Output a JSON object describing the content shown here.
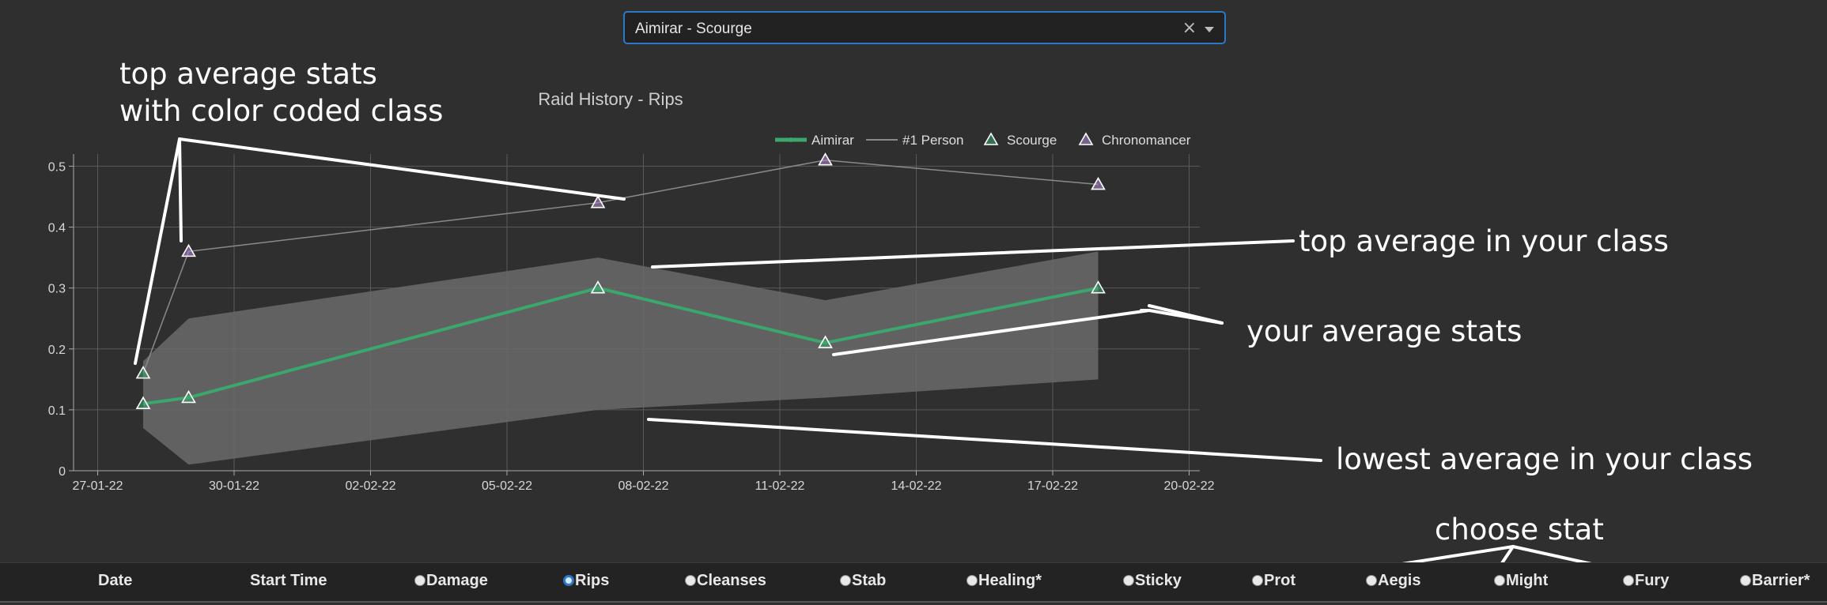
{
  "select": {
    "value": "Aimirar - Scourge",
    "clear_glyph": "×",
    "icons": [
      "clear-icon",
      "chevron-down-icon"
    ]
  },
  "chart_data": {
    "type": "line",
    "title": "Raid History - Rips",
    "x_ticks": [
      "27-01-22",
      "30-01-22",
      "02-02-22",
      "05-02-22",
      "08-02-22",
      "11-02-22",
      "14-02-22",
      "17-02-22",
      "20-02-22"
    ],
    "y_ticks": [
      "0",
      "0.1",
      "0.2",
      "0.3",
      "0.4",
      "0.5"
    ],
    "xlim": [
      "2022-01-26",
      "2022-02-20"
    ],
    "ylim": [
      0,
      0.52
    ],
    "grid": true,
    "legend_position": "top-right",
    "legend": [
      {
        "label": "Aimirar",
        "kind": "line-marker",
        "color": "#3aa76d"
      },
      {
        "label": "#1 Person",
        "kind": "thin-line",
        "color": "#8a8a8a"
      },
      {
        "label": "Scourge",
        "kind": "triangle",
        "color": "#3aa76d"
      },
      {
        "label": "Chronomancer",
        "kind": "triangle",
        "color": "#b48cd8"
      }
    ],
    "series": [
      {
        "name": "Aimirar",
        "color": "#3aa76d",
        "x": [
          "2022-01-28",
          "2022-01-29",
          "2022-02-07",
          "2022-02-12",
          "2022-02-18"
        ],
        "y": [
          0.11,
          0.12,
          0.3,
          0.21,
          0.3
        ]
      },
      {
        "name": "#1 Person",
        "color": "#8a8a8a",
        "x": [
          "2022-01-28",
          "2022-01-29",
          "2022-02-07",
          "2022-02-12",
          "2022-02-18"
        ],
        "y": [
          0.16,
          0.36,
          0.44,
          0.51,
          0.47
        ],
        "classes": [
          "Scourge",
          "Chronomancer",
          "Chronomancer",
          "Chronomancer",
          "Chronomancer"
        ]
      }
    ],
    "band": {
      "color": "#6a6a6a",
      "x": [
        "2022-01-28",
        "2022-01-29",
        "2022-02-07",
        "2022-02-12",
        "2022-02-18"
      ],
      "upper": [
        0.18,
        0.25,
        0.35,
        0.28,
        0.36
      ],
      "lower": [
        0.07,
        0.01,
        0.1,
        0.12,
        0.15
      ]
    },
    "annotations": [
      "top average stats",
      "with color coded class",
      "top average in your class",
      "your average stats",
      "lowest average in your class",
      "choose stat"
    ]
  },
  "table_header": {
    "columns": [
      {
        "label": "Date",
        "radio": false
      },
      {
        "label": "Start Time",
        "radio": false
      },
      {
        "label": "Damage",
        "radio": true,
        "checked": false
      },
      {
        "label": "Rips",
        "radio": true,
        "checked": true
      },
      {
        "label": "Cleanses",
        "radio": true,
        "checked": false
      },
      {
        "label": "Stab",
        "radio": true,
        "checked": false
      },
      {
        "label": "Healing*",
        "radio": true,
        "checked": false
      },
      {
        "label": "Sticky",
        "radio": true,
        "checked": false
      },
      {
        "label": "Prot",
        "radio": true,
        "checked": false
      },
      {
        "label": "Aegis",
        "radio": true,
        "checked": false
      },
      {
        "label": "Might",
        "radio": true,
        "checked": false
      },
      {
        "label": "Fury",
        "radio": true,
        "checked": false
      },
      {
        "label": "Barrier*",
        "radio": true,
        "checked": false
      }
    ]
  }
}
